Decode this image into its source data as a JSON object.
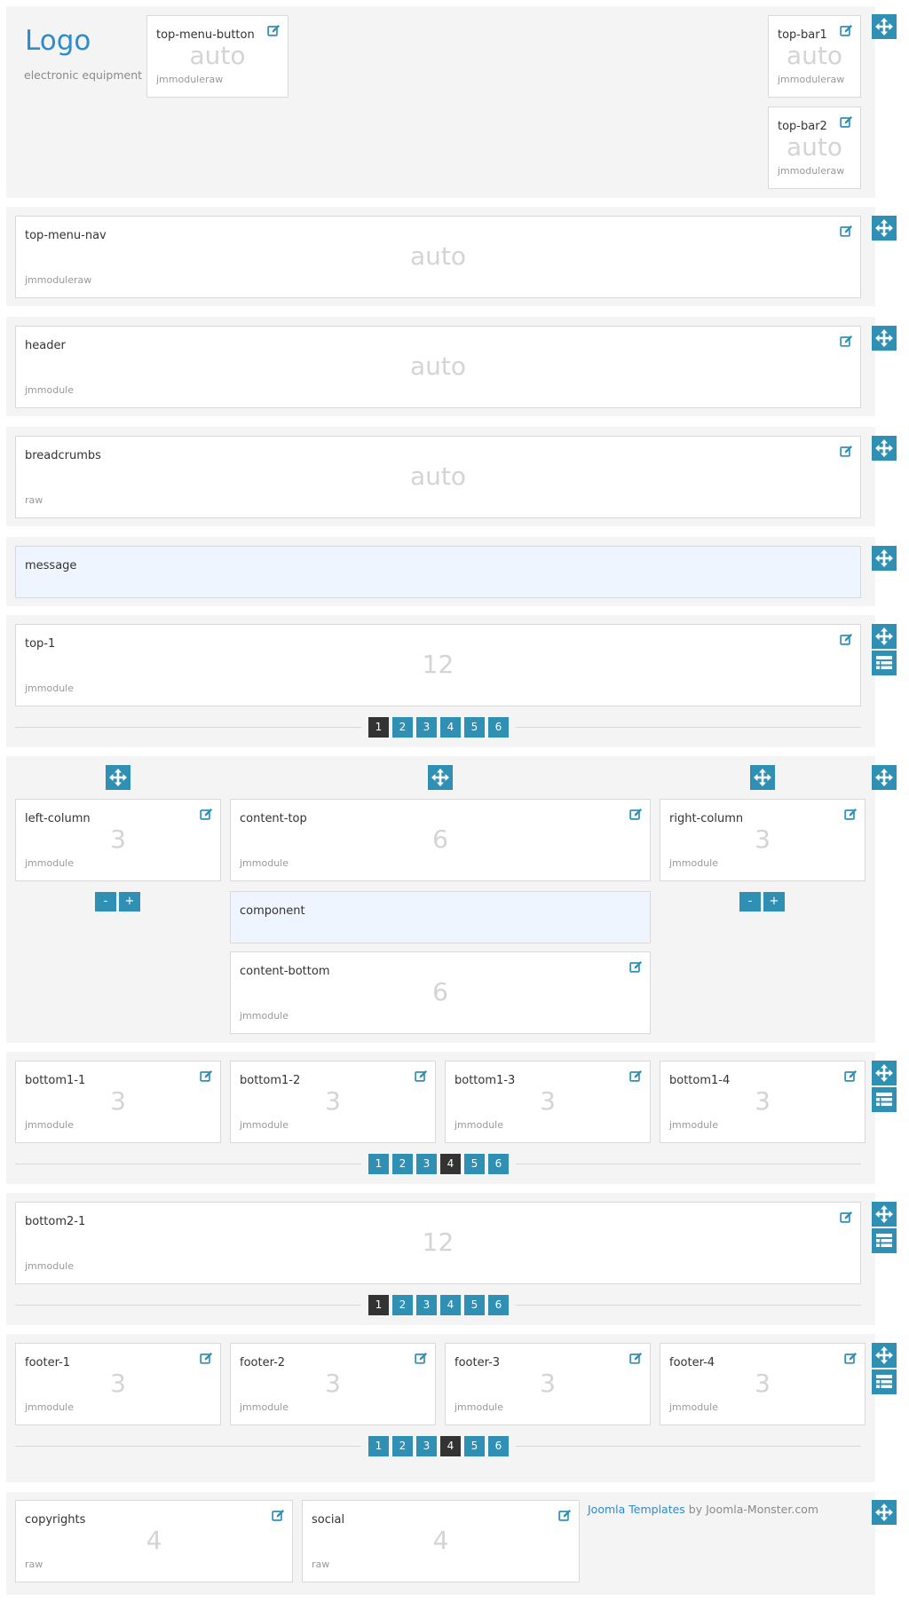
{
  "logo": {
    "text": "Logo",
    "tagline": "electronic equipment"
  },
  "modules": {
    "top_menu_button": {
      "title": "top-menu-button",
      "width": "auto",
      "chrome": "jmmoduleraw"
    },
    "top_bar1": {
      "title": "top-bar1",
      "width": "auto",
      "chrome": "jmmoduleraw"
    },
    "top_bar2": {
      "title": "top-bar2",
      "width": "auto",
      "chrome": "jmmoduleraw"
    },
    "top_menu_nav": {
      "title": "top-menu-nav",
      "width": "auto",
      "chrome": "jmmoduleraw"
    },
    "header": {
      "title": "header",
      "width": "auto",
      "chrome": "jmmodule"
    },
    "breadcrumbs": {
      "title": "breadcrumbs",
      "width": "auto",
      "chrome": "raw"
    },
    "message": {
      "title": "message"
    },
    "top_1": {
      "title": "top-1",
      "width": "12",
      "chrome": "jmmodule"
    },
    "left_column": {
      "title": "left-column",
      "width": "3",
      "chrome": "jmmodule"
    },
    "content_top": {
      "title": "content-top",
      "width": "6",
      "chrome": "jmmodule"
    },
    "right_column": {
      "title": "right-column",
      "width": "3",
      "chrome": "jmmodule"
    },
    "component": {
      "title": "component"
    },
    "content_bottom": {
      "title": "content-bottom",
      "width": "6",
      "chrome": "jmmodule"
    },
    "bottom1_1": {
      "title": "bottom1-1",
      "width": "3",
      "chrome": "jmmodule"
    },
    "bottom1_2": {
      "title": "bottom1-2",
      "width": "3",
      "chrome": "jmmodule"
    },
    "bottom1_3": {
      "title": "bottom1-3",
      "width": "3",
      "chrome": "jmmodule"
    },
    "bottom1_4": {
      "title": "bottom1-4",
      "width": "3",
      "chrome": "jmmodule"
    },
    "bottom2_1": {
      "title": "bottom2-1",
      "width": "12",
      "chrome": "jmmodule"
    },
    "footer_1": {
      "title": "footer-1",
      "width": "3",
      "chrome": "jmmodule"
    },
    "footer_2": {
      "title": "footer-2",
      "width": "3",
      "chrome": "jmmodule"
    },
    "footer_3": {
      "title": "footer-3",
      "width": "3",
      "chrome": "jmmodule"
    },
    "footer_4": {
      "title": "footer-4",
      "width": "3",
      "chrome": "jmmodule"
    },
    "copyrights": {
      "title": "copyrights",
      "width": "4",
      "chrome": "raw"
    },
    "social": {
      "title": "social",
      "width": "4",
      "chrome": "raw"
    }
  },
  "column_buttons": {
    "minus": "-",
    "plus": "+"
  },
  "pagers": {
    "top": {
      "labels": [
        "1",
        "2",
        "3",
        "4",
        "5",
        "6"
      ],
      "active": "1"
    },
    "bottom1": {
      "labels": [
        "1",
        "2",
        "3",
        "4",
        "5",
        "6"
      ],
      "active": "4"
    },
    "bottom2": {
      "labels": [
        "1",
        "2",
        "3",
        "4",
        "5",
        "6"
      ],
      "active": "1"
    },
    "footer": {
      "labels": [
        "1",
        "2",
        "3",
        "4",
        "5",
        "6"
      ],
      "active": "4"
    }
  },
  "credit": {
    "link": "Joomla Templates",
    "by": " by Joomla-Monster.com"
  },
  "icons": {
    "edit": "edit-icon",
    "move": "move-icon",
    "layout": "list-icon"
  },
  "colors": {
    "accent": "#2f90b4",
    "logo": "#2d8ccb",
    "active_page": "#333333",
    "highlight": "#eef5ff"
  }
}
